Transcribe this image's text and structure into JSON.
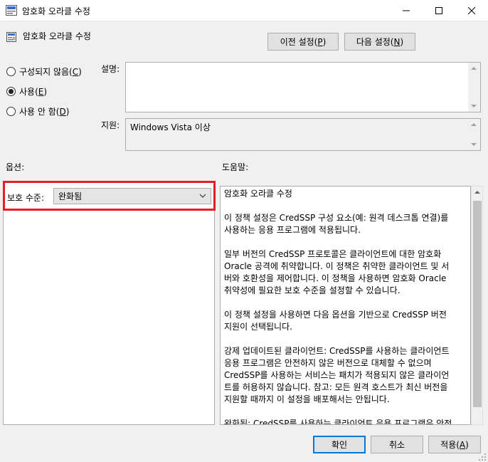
{
  "window": {
    "title": "암호화 오라클 수정",
    "controls": [
      "minimize-icon",
      "maximize-icon",
      "close-icon"
    ]
  },
  "header": {
    "policy_title": "암호화 오라클 수정",
    "prev_label": "이전 설정(",
    "prev_mnemonic": "P",
    "next_label": "다음 설정(",
    "next_mnemonic": "N"
  },
  "state": {
    "options": [
      {
        "label": "구성되지 않음(",
        "mnemonic": "C",
        "selected": false
      },
      {
        "label": "사용(",
        "mnemonic": "E",
        "selected": true
      },
      {
        "label": "사용 안 함(",
        "mnemonic": "D",
        "selected": false
      }
    ]
  },
  "comment": {
    "label": "설명:",
    "value": ""
  },
  "supported": {
    "label": "지원:",
    "value": "Windows Vista 이상"
  },
  "options_section": {
    "label": "옵션:",
    "protection_label": "보호 수준:",
    "protection_value": "완화됨"
  },
  "help_section": {
    "label": "도움말:",
    "text": "암호화 오라클 수정\n\n이 정책 설정은 CredSSP 구성 요소(예: 원격 데스크톱 연결)를\n사용하는 응용 프로그램에 적용됩니다.\n\n일부 버전의 CredSSP 프로토콜은 클라이언트에 대한 암호화\nOracle 공격에 취약합니다.  이 정책은 취약한 클라이언트 및 서\n버와 호환성을 제어합니다.  이 정책을 사용하면 암호화 Oracle\n취약성에 필요한 보호 수준을 설정할 수 있습니다.\n\n이 정책 설정을 사용하면 다음 옵션을 기반으로 CredSSP 버전\n지원이 선택됩니다.\n\n강제 업데이트된 클라이언트: CredSSP를 사용하는 클라이언트\n응용 프로그램은 안전하지 않은 버전으로 대체할 수 없으며\nCredSSP를 사용하는 서비스는 패치가 적용되지 않은 클라이언\n트를 허용하지 않습니다. 참고: 모든 원격 호스트가 최신 버전을\n지원할 때까지 이 설정을 배포해서는 안됩니다.\n\n완화됨: CredSSP를 사용하는 클라이언트 응용 프로그램은 안전\n하지 않은 버전으로 대체할 수 없지만 CredSSP를 사용하는 서비\n스는 패치가 적용되지 않은 클라이언트를 허용합니다. 패치가 적"
  },
  "footer": {
    "ok_label": "확인",
    "cancel_label": "취소",
    "apply_label": "적용(",
    "apply_mnemonic": "A"
  },
  "colors": {
    "highlight": "#e81c24",
    "default_button_border": "#0078d7"
  }
}
